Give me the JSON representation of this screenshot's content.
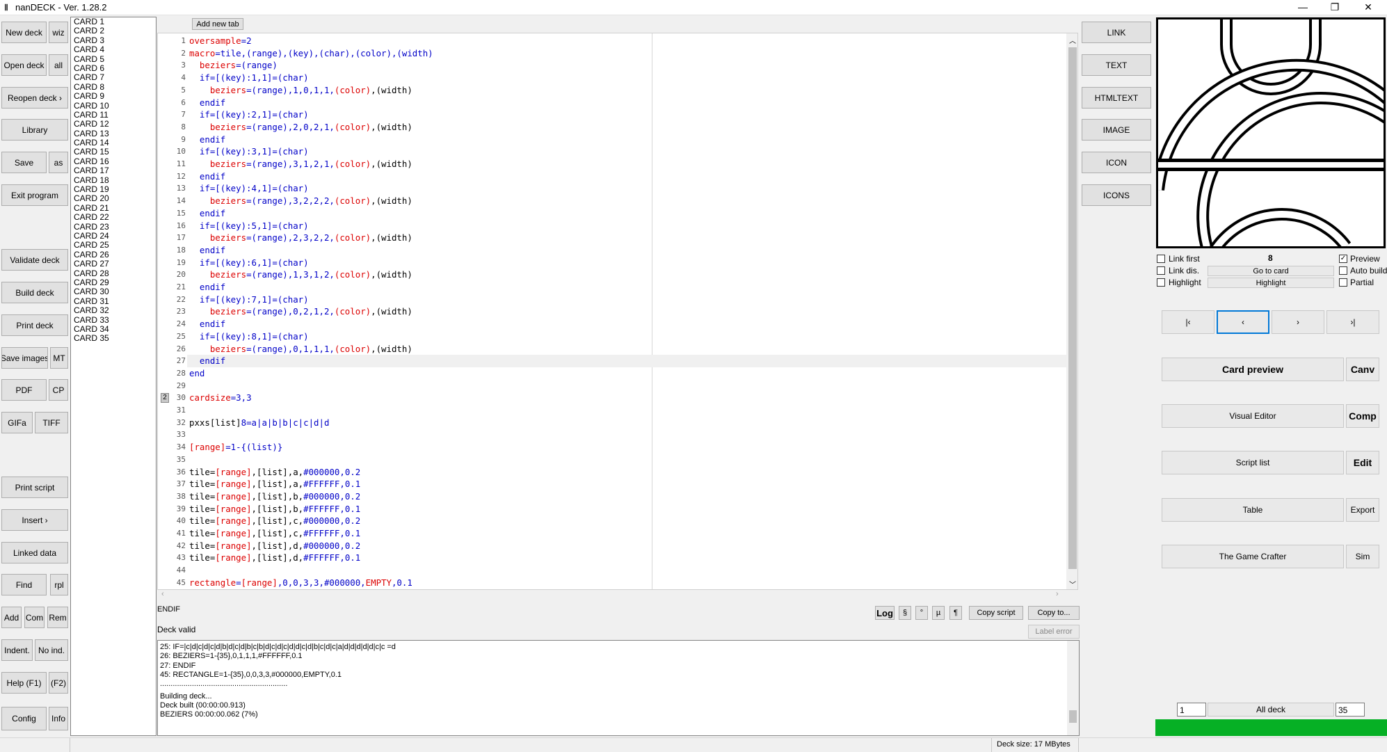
{
  "window": {
    "title": "nanDECK - Ver. 1.28.2",
    "minimize": "—",
    "maximize": "❐",
    "close": "✕"
  },
  "left_buttons": {
    "new_deck": "New deck",
    "wiz": "wiz",
    "open_deck": "Open deck",
    "all": "all",
    "reopen_deck": "Reopen deck ›",
    "library": "Library",
    "save": "Save",
    "as": "as",
    "exit_program": "Exit program",
    "validate_deck": "Validate deck",
    "build_deck": "Build deck",
    "print_deck": "Print deck",
    "save_images": "Save images",
    "mt": "MT",
    "pdf": "PDF",
    "cp": "CP",
    "gifa": "GIFa",
    "tiff": "TIFF",
    "print_script": "Print script",
    "insert": "Insert ›",
    "linked_data": "Linked data",
    "find": "Find",
    "rpl": "rpl",
    "add": "Add",
    "com": "Com",
    "rem": "Rem",
    "indent": "Indent.",
    "no_ind": "No ind.",
    "help": "Help (F1)",
    "f2": "(F2)",
    "config": "Config",
    "info": "Info"
  },
  "cards": [
    "CARD 1",
    "CARD 2",
    "CARD 3",
    "CARD 4",
    "CARD 5",
    "CARD 6",
    "CARD 7",
    "CARD 8",
    "CARD 9",
    "CARD 10",
    "CARD 11",
    "CARD 12",
    "CARD 13",
    "CARD 14",
    "CARD 15",
    "CARD 16",
    "CARD 17",
    "CARD 18",
    "CARD 19",
    "CARD 20",
    "CARD 21",
    "CARD 22",
    "CARD 23",
    "CARD 24",
    "CARD 25",
    "CARD 26",
    "CARD 27",
    "CARD 28",
    "CARD 29",
    "CARD 30",
    "CARD 31",
    "CARD 32",
    "CARD 33",
    "CARD 34",
    "CARD 35"
  ],
  "editor": {
    "add_tab": "Add new tab",
    "bookmark": "2",
    "current_line": 27,
    "lines": [
      {
        "n": "1",
        "parts": [
          [
            "rd",
            "oversample"
          ],
          [
            "kw",
            "=2"
          ]
        ]
      },
      {
        "n": "2",
        "parts": [
          [
            "rd",
            "macro"
          ],
          [
            "kw",
            "=tile,(range),(key),(char),(color),(width)"
          ]
        ]
      },
      {
        "n": "3",
        "parts": [
          [
            "",
            "  "
          ],
          [
            "rd",
            "beziers"
          ],
          [
            "kw",
            "=(range)"
          ]
        ]
      },
      {
        "n": "4",
        "parts": [
          [
            "",
            "  "
          ],
          [
            "kw",
            "if=[(key):1,1]=(char)"
          ]
        ]
      },
      {
        "n": "5",
        "parts": [
          [
            "",
            "    "
          ],
          [
            "rd",
            "beziers"
          ],
          [
            "kw",
            "=(range),1,0,1,1,"
          ],
          [
            "rd",
            "(color)"
          ],
          [
            "",
            ",(width)"
          ]
        ]
      },
      {
        "n": "6",
        "parts": [
          [
            "",
            "  "
          ],
          [
            "kw",
            "endif"
          ]
        ]
      },
      {
        "n": "7",
        "parts": [
          [
            "",
            "  "
          ],
          [
            "kw",
            "if=[(key):2,1]=(char)"
          ]
        ]
      },
      {
        "n": "8",
        "parts": [
          [
            "",
            "    "
          ],
          [
            "rd",
            "beziers"
          ],
          [
            "kw",
            "=(range),2,0,2,1,"
          ],
          [
            "rd",
            "(color)"
          ],
          [
            "",
            ",(width)"
          ]
        ]
      },
      {
        "n": "9",
        "parts": [
          [
            "",
            "  "
          ],
          [
            "kw",
            "endif"
          ]
        ]
      },
      {
        "n": "10",
        "parts": [
          [
            "",
            "  "
          ],
          [
            "kw",
            "if=[(key):3,1]=(char)"
          ]
        ]
      },
      {
        "n": "11",
        "parts": [
          [
            "",
            "    "
          ],
          [
            "rd",
            "beziers"
          ],
          [
            "kw",
            "=(range),3,1,2,1,"
          ],
          [
            "rd",
            "(color)"
          ],
          [
            "",
            ",(width)"
          ]
        ]
      },
      {
        "n": "12",
        "parts": [
          [
            "",
            "  "
          ],
          [
            "kw",
            "endif"
          ]
        ]
      },
      {
        "n": "13",
        "parts": [
          [
            "",
            "  "
          ],
          [
            "kw",
            "if=[(key):4,1]=(char)"
          ]
        ]
      },
      {
        "n": "14",
        "parts": [
          [
            "",
            "    "
          ],
          [
            "rd",
            "beziers"
          ],
          [
            "kw",
            "=(range),3,2,2,2,"
          ],
          [
            "rd",
            "(color)"
          ],
          [
            "",
            ",(width)"
          ]
        ]
      },
      {
        "n": "15",
        "parts": [
          [
            "",
            "  "
          ],
          [
            "kw",
            "endif"
          ]
        ]
      },
      {
        "n": "16",
        "parts": [
          [
            "",
            "  "
          ],
          [
            "kw",
            "if=[(key):5,1]=(char)"
          ]
        ]
      },
      {
        "n": "17",
        "parts": [
          [
            "",
            "    "
          ],
          [
            "rd",
            "beziers"
          ],
          [
            "kw",
            "=(range),2,3,2,2,"
          ],
          [
            "rd",
            "(color)"
          ],
          [
            "",
            ",(width)"
          ]
        ]
      },
      {
        "n": "18",
        "parts": [
          [
            "",
            "  "
          ],
          [
            "kw",
            "endif"
          ]
        ]
      },
      {
        "n": "19",
        "parts": [
          [
            "",
            "  "
          ],
          [
            "kw",
            "if=[(key):6,1]=(char)"
          ]
        ]
      },
      {
        "n": "20",
        "parts": [
          [
            "",
            "    "
          ],
          [
            "rd",
            "beziers"
          ],
          [
            "kw",
            "=(range),1,3,1,2,"
          ],
          [
            "rd",
            "(color)"
          ],
          [
            "",
            ",(width)"
          ]
        ]
      },
      {
        "n": "21",
        "parts": [
          [
            "",
            "  "
          ],
          [
            "kw",
            "endif"
          ]
        ]
      },
      {
        "n": "22",
        "parts": [
          [
            "",
            "  "
          ],
          [
            "kw",
            "if=[(key):7,1]=(char)"
          ]
        ]
      },
      {
        "n": "23",
        "parts": [
          [
            "",
            "    "
          ],
          [
            "rd",
            "beziers"
          ],
          [
            "kw",
            "=(range),0,2,1,2,"
          ],
          [
            "rd",
            "(color)"
          ],
          [
            "",
            ",(width)"
          ]
        ]
      },
      {
        "n": "24",
        "parts": [
          [
            "",
            "  "
          ],
          [
            "kw",
            "endif"
          ]
        ]
      },
      {
        "n": "25",
        "parts": [
          [
            "",
            "  "
          ],
          [
            "kw",
            "if=[(key):8,1]=(char)"
          ]
        ]
      },
      {
        "n": "26",
        "parts": [
          [
            "",
            "    "
          ],
          [
            "rd",
            "beziers"
          ],
          [
            "kw",
            "=(range),0,1,1,1,"
          ],
          [
            "rd",
            "(color)"
          ],
          [
            "",
            ",(width)"
          ]
        ]
      },
      {
        "n": "27",
        "parts": [
          [
            "",
            "  "
          ],
          [
            "kw",
            "endif"
          ]
        ]
      },
      {
        "n": "28",
        "parts": [
          [
            "kw",
            "end"
          ]
        ]
      },
      {
        "n": "29",
        "parts": []
      },
      {
        "n": "30",
        "parts": [
          [
            "rd",
            "cardsize"
          ],
          [
            "kw",
            "=3,3"
          ]
        ]
      },
      {
        "n": "31",
        "parts": []
      },
      {
        "n": "32",
        "parts": [
          [
            "",
            "pxxs[list]"
          ],
          [
            "kw",
            "8=a|a|b|b|c|c|d|d"
          ]
        ]
      },
      {
        "n": "33",
        "parts": []
      },
      {
        "n": "34",
        "parts": [
          [
            "rd",
            "[range]"
          ],
          [
            "kw",
            "=1-{(list)}"
          ]
        ]
      },
      {
        "n": "35",
        "parts": []
      },
      {
        "n": "36",
        "parts": [
          [
            "",
            "tile="
          ],
          [
            "rd",
            "[range]"
          ],
          [
            "",
            ",[list],a,"
          ],
          [
            "kw",
            "#000000,0.2"
          ]
        ]
      },
      {
        "n": "37",
        "parts": [
          [
            "",
            "tile="
          ],
          [
            "rd",
            "[range]"
          ],
          [
            "",
            ",[list],a,"
          ],
          [
            "kw",
            "#FFFFFF,0.1"
          ]
        ]
      },
      {
        "n": "38",
        "parts": [
          [
            "",
            "tile="
          ],
          [
            "rd",
            "[range]"
          ],
          [
            "",
            ",[list],b,"
          ],
          [
            "kw",
            "#000000,0.2"
          ]
        ]
      },
      {
        "n": "39",
        "parts": [
          [
            "",
            "tile="
          ],
          [
            "rd",
            "[range]"
          ],
          [
            "",
            ",[list],b,"
          ],
          [
            "kw",
            "#FFFFFF,0.1"
          ]
        ]
      },
      {
        "n": "40",
        "parts": [
          [
            "",
            "tile="
          ],
          [
            "rd",
            "[range]"
          ],
          [
            "",
            ",[list],c,"
          ],
          [
            "kw",
            "#000000,0.2"
          ]
        ]
      },
      {
        "n": "41",
        "parts": [
          [
            "",
            "tile="
          ],
          [
            "rd",
            "[range]"
          ],
          [
            "",
            ",[list],c,"
          ],
          [
            "kw",
            "#FFFFFF,0.1"
          ]
        ]
      },
      {
        "n": "42",
        "parts": [
          [
            "",
            "tile="
          ],
          [
            "rd",
            "[range]"
          ],
          [
            "",
            ",[list],d,"
          ],
          [
            "kw",
            "#000000,0.2"
          ]
        ]
      },
      {
        "n": "43",
        "parts": [
          [
            "",
            "tile="
          ],
          [
            "rd",
            "[range]"
          ],
          [
            "",
            ",[list],d,"
          ],
          [
            "kw",
            "#FFFFFF,0.1"
          ]
        ]
      },
      {
        "n": "44",
        "parts": []
      },
      {
        "n": "45",
        "parts": [
          [
            "rd",
            "rectangle"
          ],
          [
            "kw",
            "="
          ],
          [
            "rd",
            "[range]"
          ],
          [
            "kw",
            ",0,0,3,3,#000000,"
          ],
          [
            "rd",
            "EMPTY"
          ],
          [
            "kw",
            ",0.1"
          ]
        ]
      }
    ]
  },
  "below_editor": {
    "current_keyword": "ENDIF",
    "status": "Deck valid",
    "log_btn": "Log",
    "sym1": "§",
    "sym2": "°",
    "sym3": "µ",
    "sym4": "¶",
    "copy_script": "Copy script",
    "copy_to": "Copy to...",
    "label_error": "Label error"
  },
  "log": [
    "25: IF=|c|d|c|d|c|d|b|d|c|d|b|c|b|d|c|d|c|d|d|c|d|b|c|d|c|a|d|d|d|d|d|c|c =d",
    "26: BEZIERS=1-{35},0,1,1,1,#FFFFFF,0.1",
    "27: ENDIF",
    "45: RECTANGLE=1-{35},0,0,3,3,#000000,EMPTY,0.1",
    "............................................................",
    "Building deck...",
    "Deck built (00:00:00.913)",
    "BEZIERS 00:00:00.062 (7%)"
  ],
  "insert_buttons": {
    "link": "LINK",
    "text": "TEXT",
    "htmltext": "HTMLTEXT",
    "image": "IMAGE",
    "icon": "ICON",
    "icons": "ICONS"
  },
  "preview_panel": {
    "link_first": "Link first",
    "link_dis": "Link dis.",
    "highlight_chk": "Highlight",
    "card_number": "8",
    "go_to_card": "Go to card",
    "highlight_btn": "Highlight",
    "preview": "Preview",
    "auto_build": "Auto build",
    "partial": "Partial",
    "nav_first": "|‹",
    "nav_prev": "‹",
    "nav_next": "›",
    "nav_last": "›|",
    "card_preview": "Card preview",
    "canv": "Canv",
    "visual_editor": "Visual Editor",
    "comp": "Comp",
    "script_list": "Script list",
    "edit": "Edit",
    "table": "Table",
    "export": "Export",
    "game_crafter": "The Game Crafter",
    "sim": "Sim",
    "range_from": "1",
    "all_deck": "All deck",
    "range_to": "35"
  },
  "status_bar": {
    "deck_size": "Deck size: 17 MBytes"
  },
  "colors": {
    "progress": "#06b025",
    "keyword": "#0000c8",
    "command": "#dc0000"
  }
}
